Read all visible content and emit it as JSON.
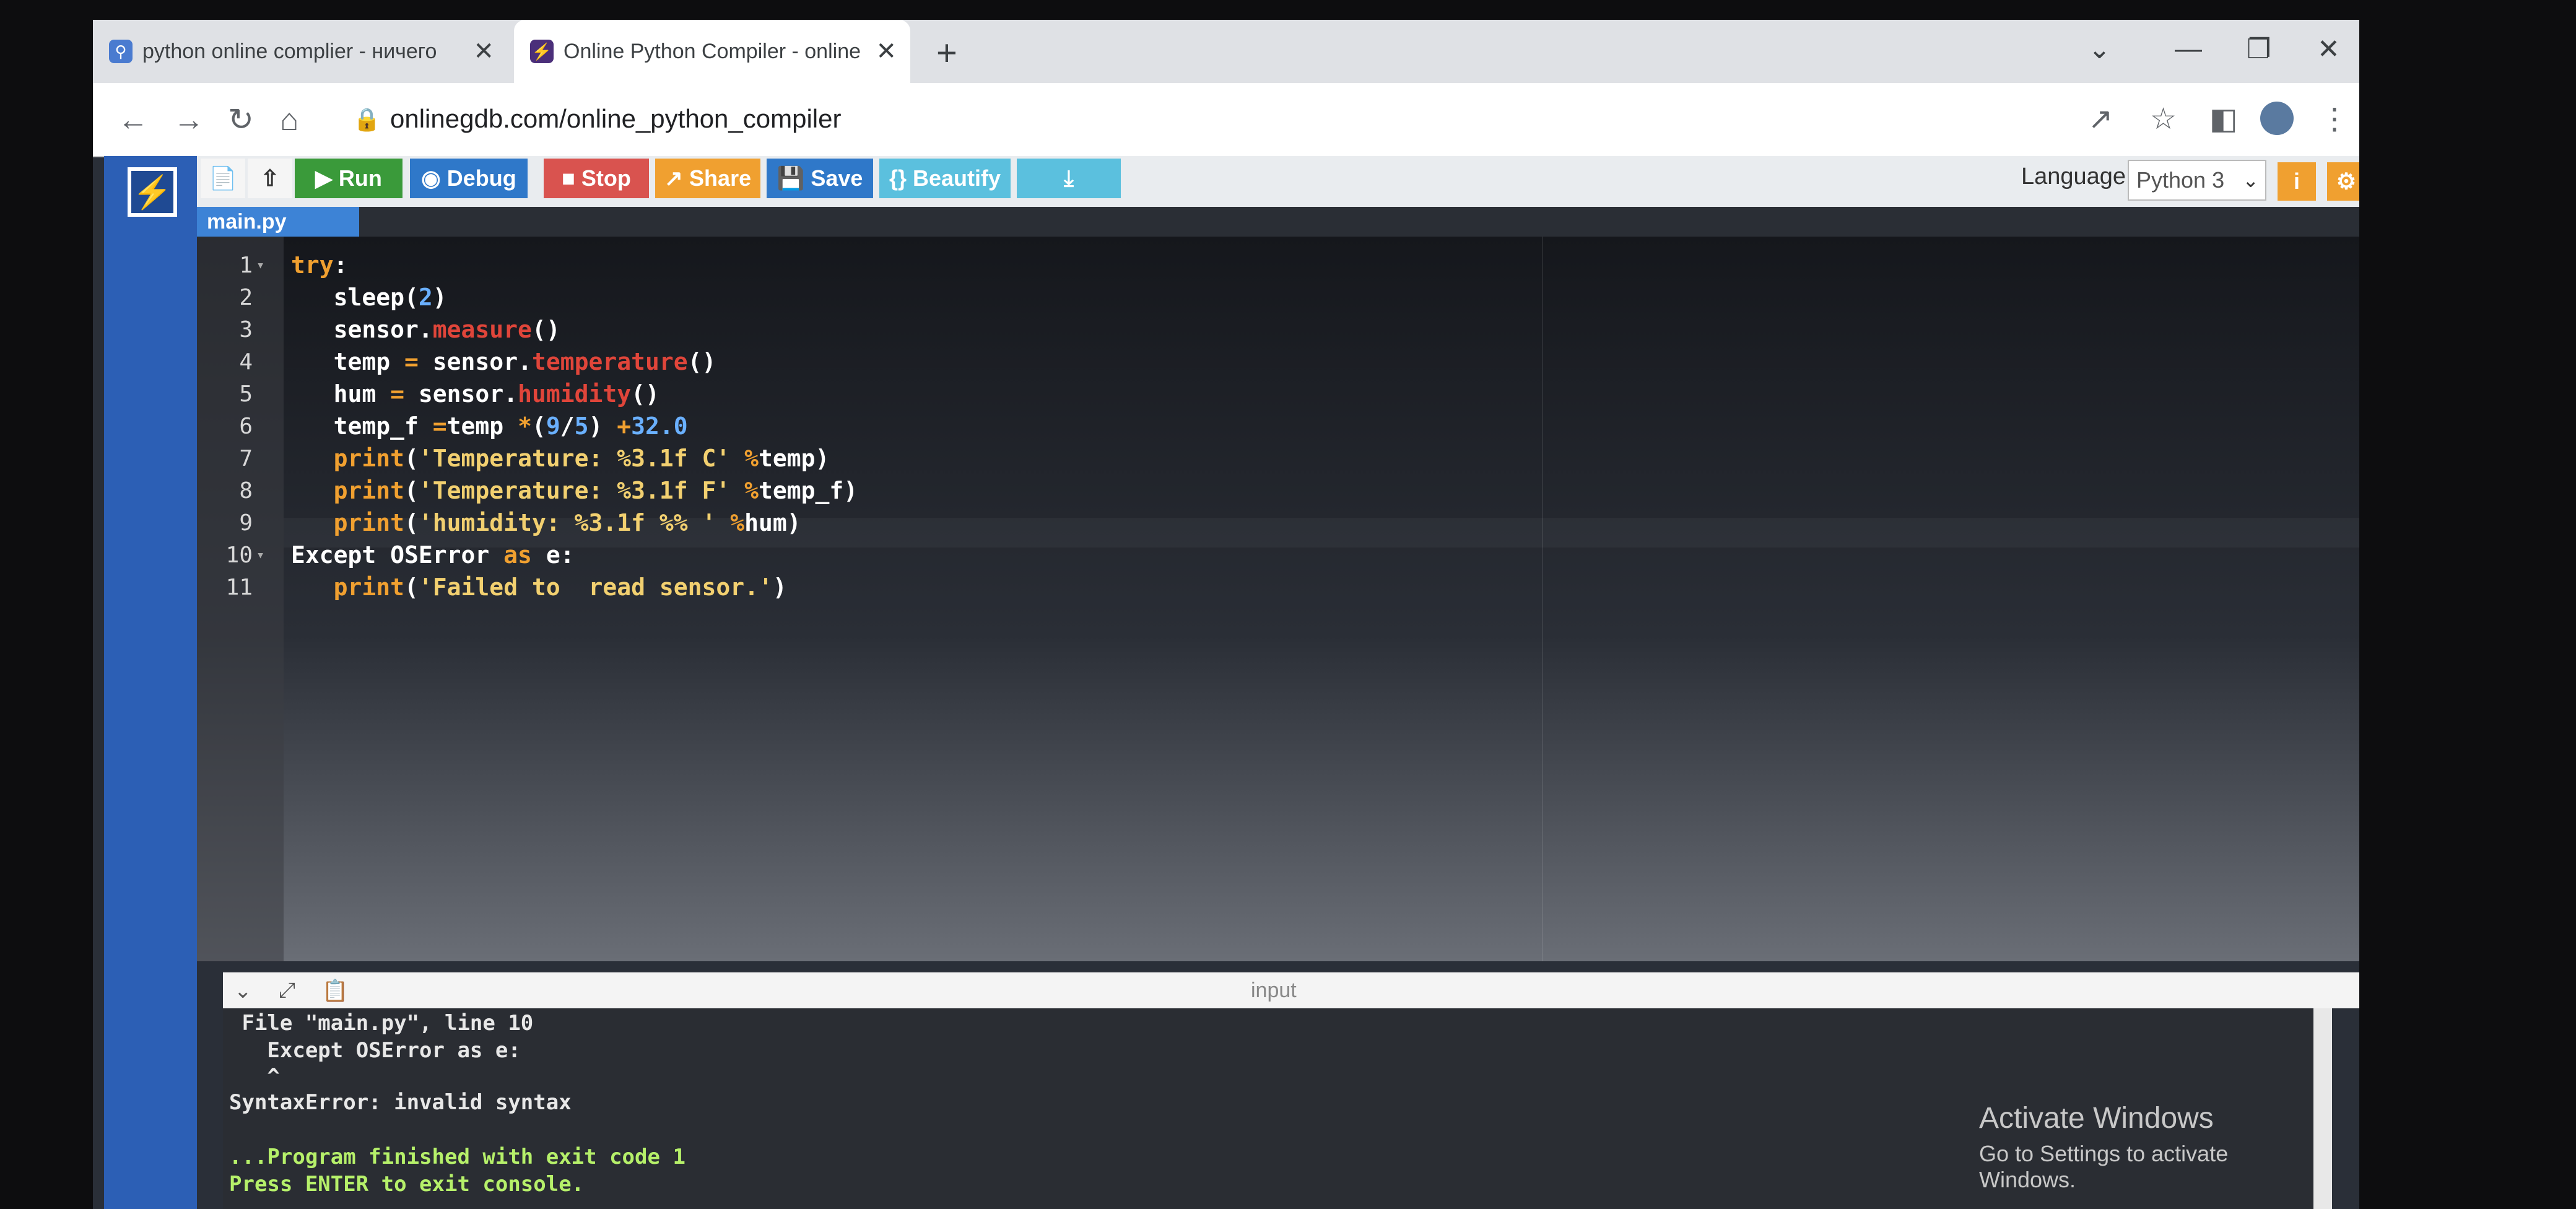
{
  "browser": {
    "tabs": [
      {
        "title": "python online complier - ничего",
        "icon": "search-icon"
      },
      {
        "title": "Online Python Compiler - online",
        "icon": "onlinegdb-bolt-icon",
        "active": true
      }
    ],
    "url": "onlinegdb.com/online_python_compiler"
  },
  "toolbar": {
    "run": "Run",
    "debug": "Debug",
    "stop": "Stop",
    "share": "Share",
    "save": "Save",
    "beautify": "{} Beautify",
    "language_label": "Language",
    "language_value": "Python 3",
    "colors": {
      "run": "#3a9a3a",
      "debug": "#2f78c9",
      "stop": "#d9534f",
      "share": "#f0a030",
      "save": "#2f78c9",
      "beautify": "#5bc0de",
      "download": "#5bc0de"
    }
  },
  "editor": {
    "file_tab": "main.py",
    "line_numbers": [
      "1",
      "2",
      "3",
      "4",
      "5",
      "6",
      "7",
      "8",
      "9",
      "10",
      "11"
    ]
  },
  "console": {
    "title": "input",
    "lines": [
      " File \"main.py\", line 10",
      "   Except OSError as e:",
      "   ^",
      "SyntaxError: invalid syntax",
      "",
      "",
      "...Program finished with exit code 1",
      "Press ENTER to exit console."
    ]
  },
  "watermark": {
    "title": "Activate Windows",
    "subtitle": "Go to Settings to activate Windows."
  }
}
